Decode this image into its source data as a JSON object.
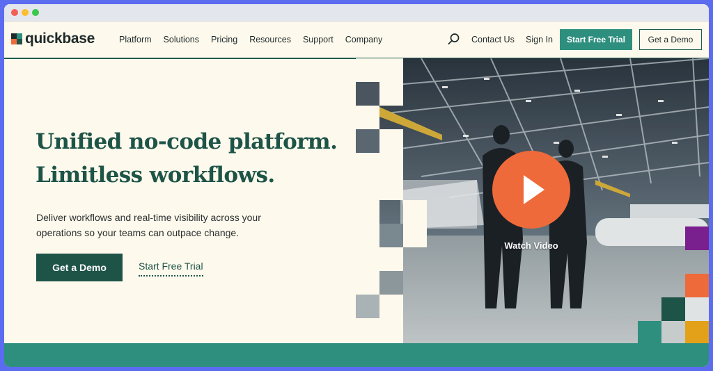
{
  "brand": {
    "name": "quickbase",
    "logo_colors": [
      "#1e5448",
      "#ef6a3a",
      "#2e8f7f",
      "#1e2a2a"
    ]
  },
  "nav": {
    "links": [
      "Platform",
      "Solutions",
      "Pricing",
      "Resources",
      "Support",
      "Company"
    ],
    "search_icon": "search-icon",
    "contact": "Contact Us",
    "signin": "Sign In",
    "trial_button": "Start Free Trial",
    "demo_button": "Get a Demo"
  },
  "hero": {
    "title_line1": "Unified no-code platform.",
    "title_line2": "Limitless workflows.",
    "subtitle": "Deliver workflows and real-time visibility across your operations so your teams can outpace change.",
    "primary_cta": "Get a Demo",
    "secondary_cta": "Start Free Trial"
  },
  "video": {
    "play_icon": "play-icon",
    "label": "Watch Video"
  },
  "colors": {
    "page_bg": "#fdf9ec",
    "heading": "#1e5448",
    "accent_teal": "#2e8f7f",
    "accent_orange": "#ef6a3a",
    "accent_purple": "#7a1f8e",
    "accent_gold": "#e3a11a"
  }
}
